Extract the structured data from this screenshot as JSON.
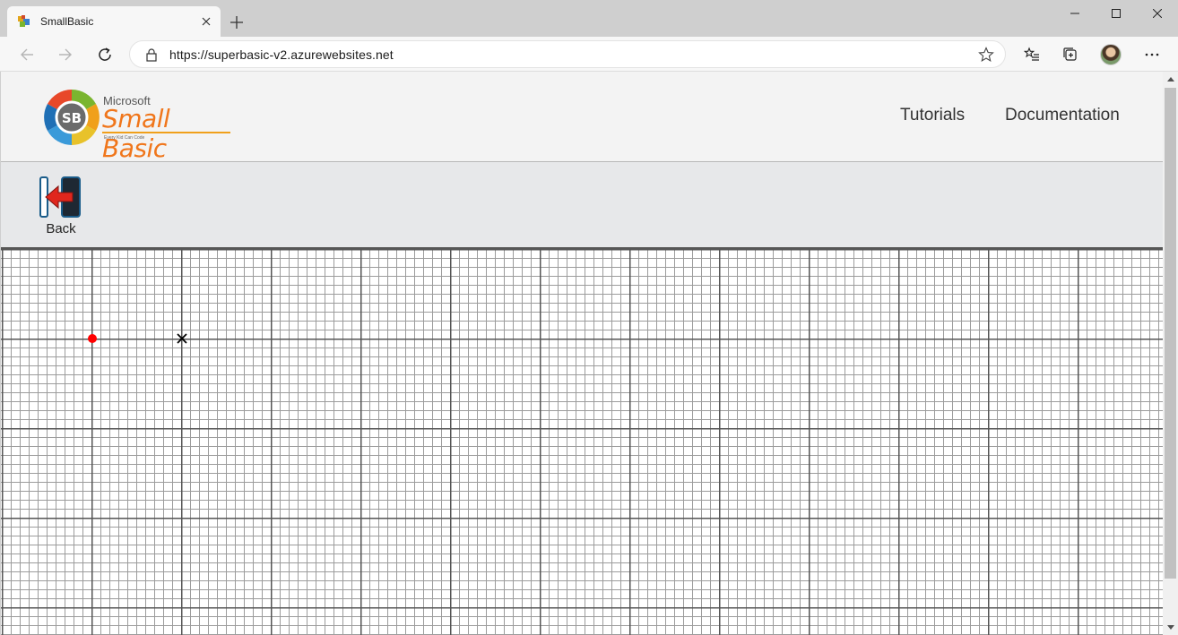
{
  "browser": {
    "tab_title": "SmallBasic",
    "url": "https://superbasic-v2.azurewebsites.net",
    "icons": {
      "back": "arrow-left-icon",
      "forward": "arrow-right-icon",
      "refresh": "refresh-icon",
      "lock": "lock-icon",
      "favorite": "star-icon",
      "favorites_bar": "favorites-icon",
      "collections": "collections-icon",
      "menu": "more-icon"
    }
  },
  "site": {
    "logo": {
      "brand": "Microsoft",
      "product": "Small Basic",
      "tagline": "Every Kid Can Code"
    },
    "nav": [
      "Tutorials",
      "Documentation"
    ],
    "actions": {
      "back_label": "Back"
    }
  },
  "canvas": {
    "markers": [
      {
        "type": "dot",
        "color": "#ff0000"
      },
      {
        "type": "cross",
        "color": "#000000"
      }
    ]
  },
  "colors": {
    "accent_orange": "#f0761b",
    "grid_major": "#555555",
    "grid_minor": "#9c9c9c"
  }
}
